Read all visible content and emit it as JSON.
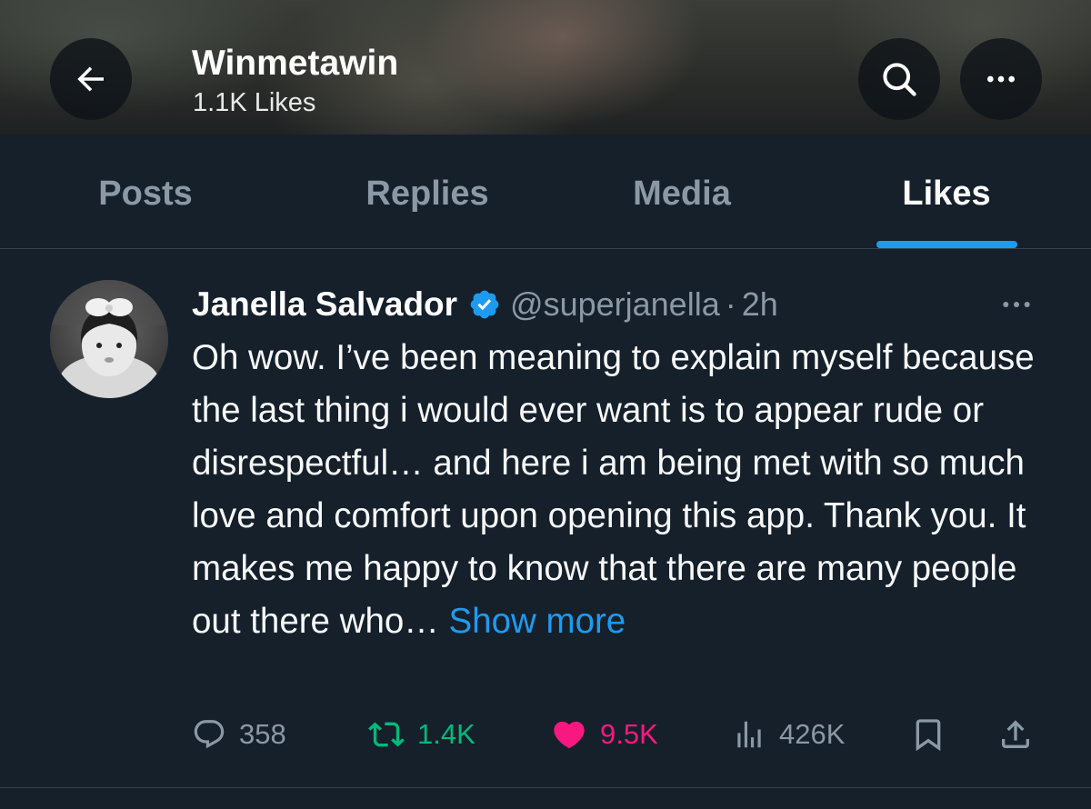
{
  "profile": {
    "name": "Winmetawin",
    "likes_count": "1.1K Likes"
  },
  "tabs": [
    {
      "label": "Posts",
      "active": false
    },
    {
      "label": "Replies",
      "active": false
    },
    {
      "label": "Media",
      "active": false
    },
    {
      "label": "Likes",
      "active": true
    }
  ],
  "post": {
    "author_name": "Janella Salvador",
    "verified": true,
    "handle": "@superjanella",
    "separator": "·",
    "time": "2h",
    "text": "Oh wow. I’ve been meaning to explain myself because the last thing i would ever want is to appear rude or disrespectful… and here i am being met with so much love and comfort upon opening this app. Thank you. It makes me happy to know that there are many people out there who…",
    "show_more": "Show more",
    "stats": {
      "replies": "358",
      "reposts": "1.4K",
      "likes": "9.5K",
      "views": "426K"
    },
    "liked": true,
    "reposted": true
  },
  "colors": {
    "background": "#15202b",
    "accent": "#1d9bf0",
    "like": "#f91880",
    "repost": "#00ba7c",
    "muted_text": "#8b98a5"
  },
  "icons": [
    "back-arrow-icon",
    "search-icon",
    "more-icon",
    "verified-badge-icon",
    "reply-icon",
    "retweet-icon",
    "heart-icon",
    "views-icon",
    "bookmark-icon",
    "share-icon"
  ]
}
